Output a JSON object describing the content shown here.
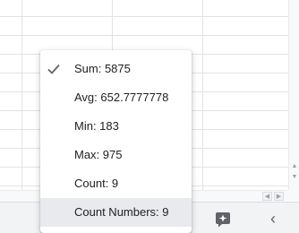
{
  "summary_menu": {
    "items": [
      {
        "label": "Sum: 5875",
        "checked": true
      },
      {
        "label": "Avg: 652.7777778",
        "checked": false
      },
      {
        "label": "Min: 183",
        "checked": false
      },
      {
        "label": "Max: 975",
        "checked": false
      },
      {
        "label": "Count: 9",
        "checked": false
      },
      {
        "label": "Count Numbers: 9",
        "checked": false,
        "hovered": true
      }
    ]
  },
  "icons": {
    "check": "checkmark-icon",
    "explore": "explore-sparkle-icon",
    "collapse": "chevron-left-icon",
    "scroll_up": "scroll-up-arrow-icon",
    "scroll_down": "scroll-down-arrow-icon",
    "scroll_left": "scroll-left-arrow-icon",
    "scroll_right": "scroll-right-arrow-icon"
  },
  "colors": {
    "grid_line": "#e2e3e3",
    "status_bar": "#f1f3f4",
    "hover": "#e8eaed",
    "icon": "#5f6368"
  }
}
